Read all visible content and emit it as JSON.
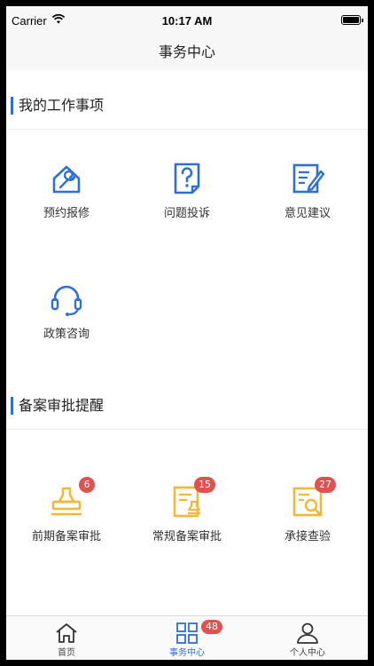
{
  "status_bar": {
    "carrier": "Carrier",
    "time": "10:17 AM"
  },
  "nav": {
    "title": "事务中心"
  },
  "work_section": {
    "title": "我的工作事项",
    "items": [
      {
        "label": "预约报修",
        "icon": "wrench-house-icon"
      },
      {
        "label": "问题投诉",
        "icon": "question-document-icon"
      },
      {
        "label": "意见建议",
        "icon": "pen-note-icon"
      },
      {
        "label": "政策咨询",
        "icon": "headset-icon"
      }
    ]
  },
  "approval_section": {
    "title": "备案审批提醒",
    "items": [
      {
        "label": "前期备案审批",
        "badge": "6",
        "icon": "stamp-icon"
      },
      {
        "label": "常规备案审批",
        "badge": "15",
        "icon": "stamped-document-icon"
      },
      {
        "label": "承接查验",
        "badge": "27",
        "icon": "inspect-document-icon"
      }
    ]
  },
  "tab_bar": {
    "tabs": [
      {
        "label": "首页",
        "icon": "home-icon",
        "active": false
      },
      {
        "label": "事务中心",
        "icon": "grid-icon",
        "active": true,
        "badge": "48"
      },
      {
        "label": "个人中心",
        "icon": "person-icon",
        "active": false
      }
    ]
  },
  "colors": {
    "accent_blue": "#2f6fd6",
    "accent_yellow": "#f3b73a",
    "badge_red": "#e25050"
  }
}
